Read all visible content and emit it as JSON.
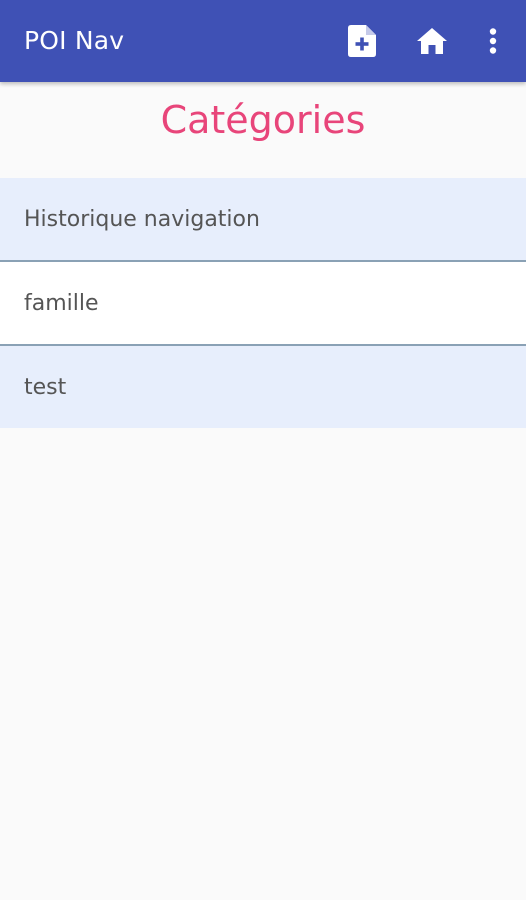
{
  "app_bar": {
    "title": "POI Nav",
    "actions": [
      {
        "icon": "note-add-icon"
      },
      {
        "icon": "home-icon"
      },
      {
        "icon": "more-vert-icon"
      }
    ],
    "background": "#3f51b5"
  },
  "page": {
    "heading": "Catégories",
    "heading_color": "#e8457a"
  },
  "categories": [
    {
      "label": "Historique navigation"
    },
    {
      "label": "famille"
    },
    {
      "label": "test"
    }
  ]
}
